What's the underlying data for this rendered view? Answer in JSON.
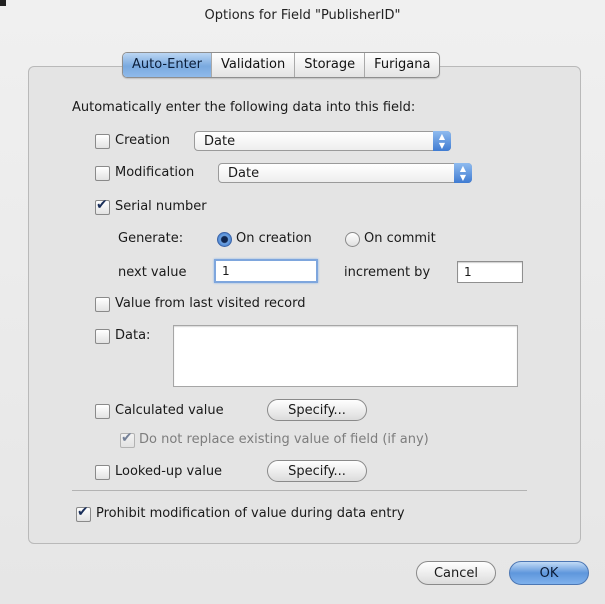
{
  "window": {
    "title": "Options for Field \"PublisherID\""
  },
  "tabs": [
    {
      "label": "Auto-Enter",
      "active": true
    },
    {
      "label": "Validation",
      "active": false
    },
    {
      "label": "Storage",
      "active": false
    },
    {
      "label": "Furigana",
      "active": false
    }
  ],
  "auto_enter": {
    "intro": "Automatically enter the following data into this field:",
    "creation": {
      "label": "Creation",
      "checked": false,
      "selected": "Date"
    },
    "modification": {
      "label": "Modification",
      "checked": false,
      "selected": "Date"
    },
    "serial": {
      "label": "Serial number",
      "checked": true,
      "generate_label": "Generate:",
      "on_creation": "On creation",
      "on_commit": "On commit",
      "selected_option": "On creation",
      "next_value_label": "next value",
      "next_value": "1",
      "increment_label": "increment by",
      "increment": "1"
    },
    "last_visited": {
      "label": "Value from last visited record",
      "checked": false
    },
    "data": {
      "label": "Data:",
      "checked": false,
      "value": ""
    },
    "calculated": {
      "label": "Calculated value",
      "checked": false,
      "specify": "Specify...",
      "no_replace": "Do not replace existing value of field (if any)",
      "no_replace_checked": true
    },
    "looked_up": {
      "label": "Looked-up value",
      "checked": false,
      "specify": "Specify..."
    },
    "prohibit": {
      "label": "Prohibit modification of value during data entry",
      "checked": true
    }
  },
  "buttons": {
    "cancel": "Cancel",
    "ok": "OK"
  },
  "icons": {
    "checkmark": "check-icon",
    "popup_arrows": "updown-arrows-icon"
  }
}
